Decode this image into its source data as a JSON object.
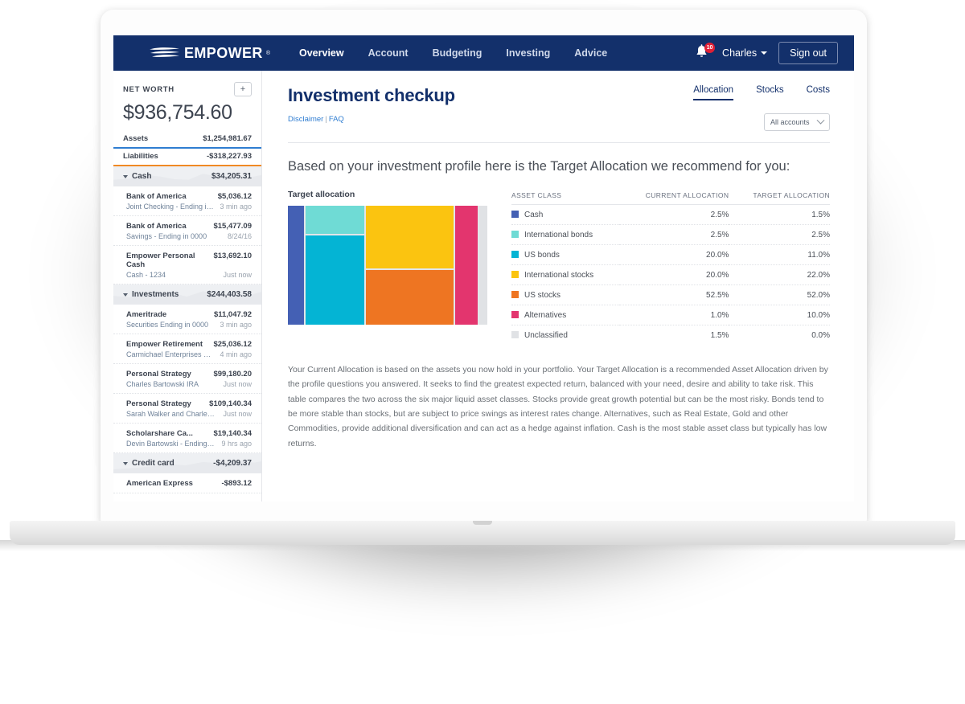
{
  "nav": {
    "brand": "EMPOWER",
    "links": [
      {
        "label": "Overview",
        "active": true
      },
      {
        "label": "Account",
        "active": false
      },
      {
        "label": "Budgeting",
        "active": false
      },
      {
        "label": "Investing",
        "active": false
      },
      {
        "label": "Advice",
        "active": false
      }
    ],
    "notification_count": "10",
    "user_name": "Charles",
    "sign_out": "Sign out",
    "bar_color": "#13306b"
  },
  "sidebar": {
    "net_worth_label": "NET WORTH",
    "add_button": "+",
    "net_worth_value": "$936,754.60",
    "assets_label": "Assets",
    "assets_value": "$1,254,981.67",
    "liabilities_label": "Liabilities",
    "liabilities_value": "-$318,227.93",
    "sections": [
      {
        "name": "Cash",
        "total": "$34,205.31",
        "accounts": [
          {
            "name": "Bank of America",
            "balance": "$5,036.12",
            "sub": "Joint Checking - Ending in...",
            "time": "3 min ago"
          },
          {
            "name": "Bank of America",
            "balance": "$15,477.09",
            "sub": "Savings - Ending in 0000",
            "time": "8/24/16"
          },
          {
            "name": "Empower Personal Cash",
            "balance": "$13,692.10",
            "sub": "Cash - 1234",
            "time": "Just now"
          }
        ]
      },
      {
        "name": "Investments",
        "total": "$244,403.58",
        "accounts": [
          {
            "name": "Ameritrade",
            "balance": "$11,047.92",
            "sub": "Securities Ending in 0000",
            "time": "3 min ago"
          },
          {
            "name": "Empower Retirement",
            "balance": "$25,036.12",
            "sub": "Carmichael Enterprises Llc 4...",
            "time": "4 min ago"
          },
          {
            "name": "Personal Strategy",
            "balance": "$99,180.20",
            "sub": "Charles Bartowski IRA",
            "time": "Just now"
          },
          {
            "name": "Personal Strategy",
            "balance": "$109,140.34",
            "sub": "Sarah Walker and Charles Ba...",
            "time": "Just now"
          },
          {
            "name": "Scholarshare Ca...",
            "balance": "$19,140.34",
            "sub": "Devin Bartowski - Ending i...",
            "time": "9 hrs ago"
          }
        ]
      },
      {
        "name": "Credit card",
        "total": "-$4,209.37",
        "accounts": [
          {
            "name": "American Express",
            "balance": "-$893.12",
            "sub": "",
            "time": ""
          }
        ]
      }
    ]
  },
  "page": {
    "title": "Investment checkup",
    "disclaimer_link": "Disclaimer",
    "faq_link": "FAQ",
    "separator": "|",
    "tabs": [
      {
        "label": "Allocation",
        "active": true
      },
      {
        "label": "Stocks",
        "active": false
      },
      {
        "label": "Costs",
        "active": false
      }
    ],
    "account_filter": "All accounts",
    "lede": "Based on your investment profile here is the Target Allocation we recommend for you:",
    "body": "Your Current Allocation is based on the assets you now hold in your portfolio. Your Target Allocation is a recommended Asset Allocation driven by the profile questions you answered. It seeks to find the greatest expected return, balanced with your need, desire and ability to take risk. This table compares the two across the six major liquid asset classes. Stocks provide great growth potential but can be the most risky. Bonds tend to be more stable than stocks, but are subject to price swings as interest rates change. Alternatives, such as Real Estate, Gold and other Commodities, provide additional diversification and can act as a hedge against inflation. Cash is the most stable asset class but typically has low returns."
  },
  "chart_data": {
    "type": "treemap",
    "title": "Target allocation",
    "columns": [
      "ASSET CLASS",
      "CURRENT ALLOCATION",
      "TARGET ALLOCATION"
    ],
    "categories": [
      "Cash",
      "International bonds",
      "US bonds",
      "International stocks",
      "US stocks",
      "Alternatives",
      "Unclassified"
    ],
    "series": [
      {
        "name": "Current allocation",
        "values": [
          2.5,
          2.5,
          20.0,
          20.0,
          52.5,
          1.0,
          1.5
        ]
      },
      {
        "name": "Target allocation",
        "values": [
          1.5,
          2.5,
          11.0,
          22.0,
          52.0,
          10.0,
          0.0
        ]
      }
    ],
    "current_labels": [
      "2.5%",
      "2.5%",
      "20.0%",
      "20.0%",
      "52.5%",
      "1.0%",
      "1.5%"
    ],
    "target_labels": [
      "1.5%",
      "2.5%",
      "11.0%",
      "22.0%",
      "52.0%",
      "10.0%",
      "0.0%"
    ],
    "colors": [
      "#4460b4",
      "#6fdbd5",
      "#04b4d4",
      "#fbc410",
      "#ee7522",
      "#e3356e",
      "#e0e2e5"
    ],
    "treemap_note": "Treemap of Target Allocation: Cash narrow left band, International bonds and US bonds stacked in second column, International stocks above US stocks in wide center, Alternatives tall right band, Unclassified thin gray right edge"
  }
}
